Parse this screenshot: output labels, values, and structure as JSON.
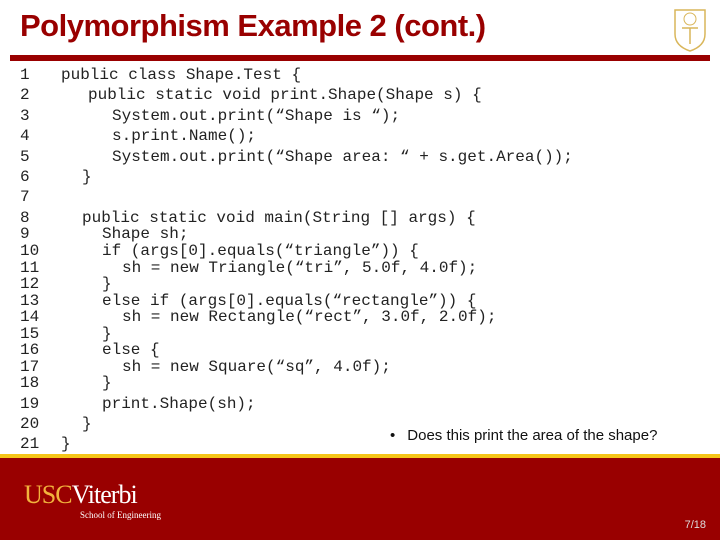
{
  "slide": {
    "title": "Polymorphism Example 2 (cont.)",
    "page": "7/18",
    "bullet": "Does this print the area of the shape?"
  },
  "code": [
    "public class Shape.Test {",
    "public static void print.Shape(Shape s) {",
    "System.out.print(“Shape is “);",
    "s.print.Name();",
    "System.out.print(“Shape area: “ + s.get.Area());",
    "}",
    "",
    "public static void main(String [] args) {",
    "Shape sh;",
    "if (args[0].equals(“triangle”)) {",
    "sh = new Triangle(“tri”, 5.0f, 4.0f);",
    "}",
    "else if (args[0].equals(“rectangle”)) {",
    "sh = new Rectangle(“rect”, 3.0f, 2.0f);",
    "}",
    "else {",
    "sh = new Square(“sq”, 4.0f);",
    "}",
    "print.Shape(sh);",
    "}",
    "}"
  ],
  "footer": {
    "logo_usc": "USC",
    "logo_viterbi": "Viterbi",
    "logo_school": "School of Engineering"
  },
  "colors": {
    "brand": "#990000",
    "accent": "#f5c518",
    "gold": "#f2b33d"
  }
}
